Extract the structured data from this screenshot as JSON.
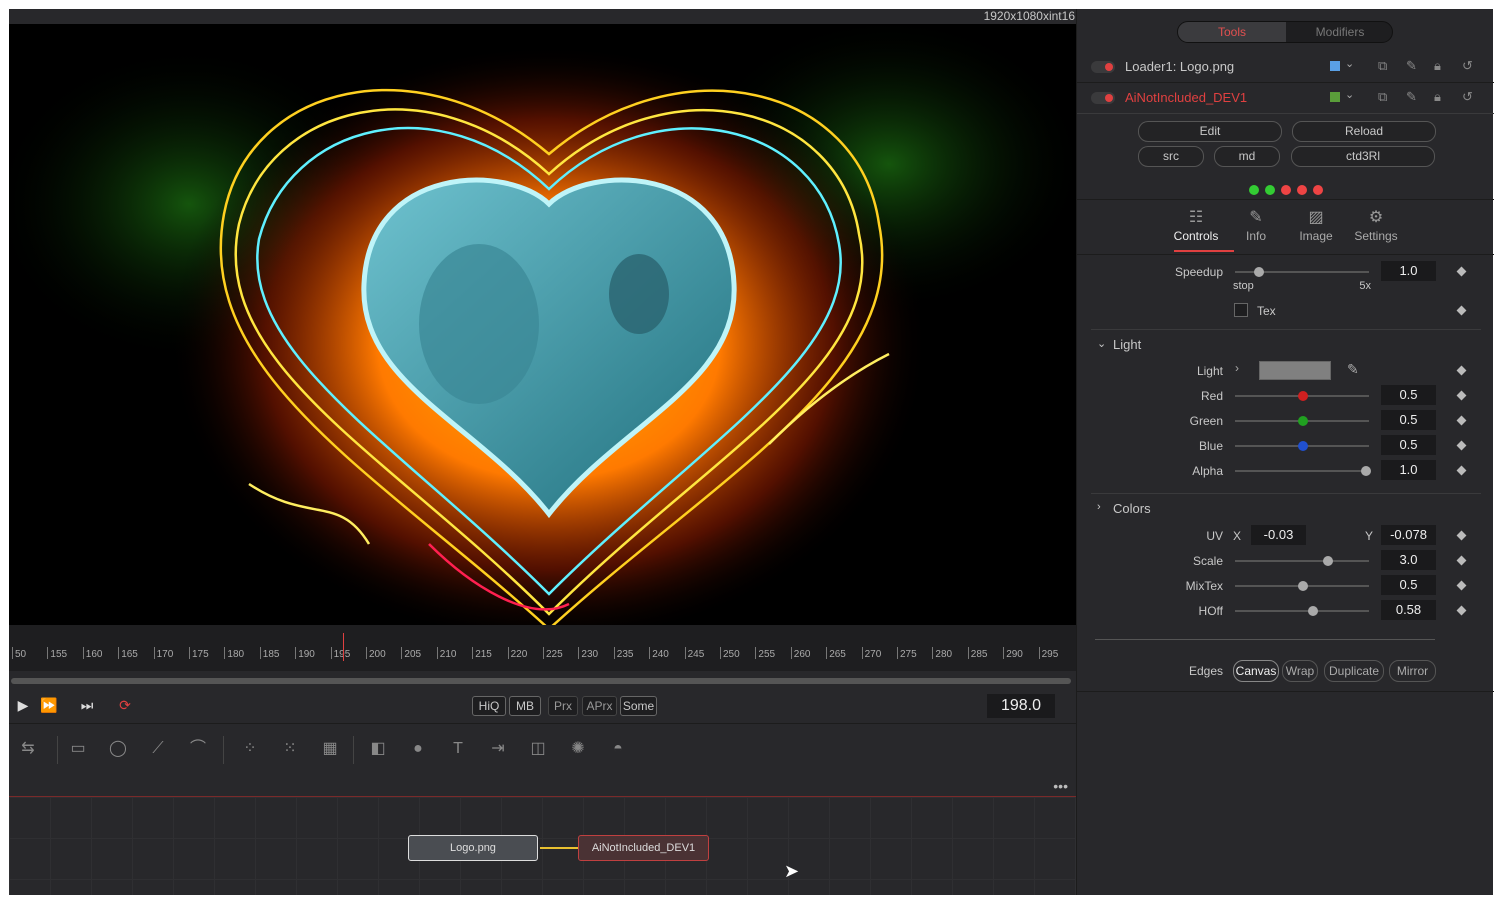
{
  "viewer": {
    "resolution": "1920x1080xint16"
  },
  "timeline": {
    "ticks": [
      "50",
      "155",
      "160",
      "165",
      "170",
      "175",
      "180",
      "185",
      "190",
      "195",
      "200",
      "205",
      "210",
      "215",
      "220",
      "225",
      "230",
      "235",
      "240",
      "245",
      "250",
      "255",
      "260",
      "265",
      "270",
      "275",
      "280",
      "285",
      "290",
      "295"
    ],
    "current_frame": "198.0"
  },
  "transport": {
    "quality_buttons": [
      "HiQ",
      "MB",
      "Prx",
      "APrx",
      "Some"
    ]
  },
  "nodes": {
    "loader": "Logo.png",
    "effect": "AiNotIncluded_DEV1"
  },
  "inspector": {
    "tabs": [
      "Tools",
      "Modifiers"
    ],
    "tools": [
      {
        "name": "Loader1: Logo.png",
        "color": "#5aa0e6"
      },
      {
        "name": "AiNotIncluded_DEV1",
        "color": "#5a9e3a"
      }
    ],
    "buttons": {
      "edit": "Edit",
      "reload": "Reload",
      "src": "src",
      "md": "md",
      "ctd3rl": "ctd3Rl"
    },
    "subtabs": [
      "Controls",
      "Info",
      "Image",
      "Settings"
    ],
    "speedup": {
      "label": "Speedup",
      "value": "1.0",
      "min_label": "stop",
      "max_label": "5x",
      "level": 0.15
    },
    "tex": {
      "label": "Tex"
    },
    "light_section": "Light",
    "light": {
      "label": "Light"
    },
    "channels": [
      {
        "label": "Red",
        "value": "0.5",
        "color": "#d02020",
        "level": 0.5
      },
      {
        "label": "Green",
        "value": "0.5",
        "color": "#20a020",
        "level": 0.5
      },
      {
        "label": "Blue",
        "value": "0.5",
        "color": "#2050d0",
        "level": 0.5
      },
      {
        "label": "Alpha",
        "value": "1.0",
        "color": "#aaaaaa",
        "level": 1.0
      }
    ],
    "colors_section": "Colors",
    "uv": {
      "label": "UV",
      "x_label": "X",
      "x": "-0.03",
      "y_label": "Y",
      "y": "-0.078"
    },
    "params": [
      {
        "label": "Scale",
        "value": "3.0",
        "level": 0.7
      },
      {
        "label": "MixTex",
        "value": "0.5",
        "level": 0.5
      },
      {
        "label": "HOff",
        "value": "0.58",
        "level": 0.58
      }
    ],
    "edges": {
      "label": "Edges",
      "options": [
        "Canvas",
        "Wrap",
        "Duplicate",
        "Mirror"
      ],
      "selected": "Canvas"
    }
  }
}
